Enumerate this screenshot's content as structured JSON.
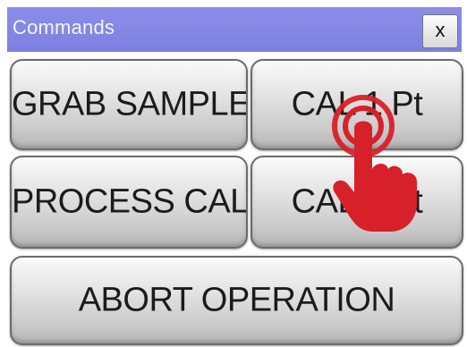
{
  "window": {
    "title": "Commands",
    "close_label": "x",
    "title_color": "#7d80e2"
  },
  "commands": {
    "grab_sample": "GRAB SAMPLE",
    "cal_1pt": "CAL 1 Pt",
    "process_cal": "PROCESS CAL",
    "cal_2pt": "CAL 2 Pt",
    "abort_operation": "ABORT OPERATION"
  },
  "overlay": {
    "icon": "tap-hand-icon",
    "color": "#d8202a"
  }
}
